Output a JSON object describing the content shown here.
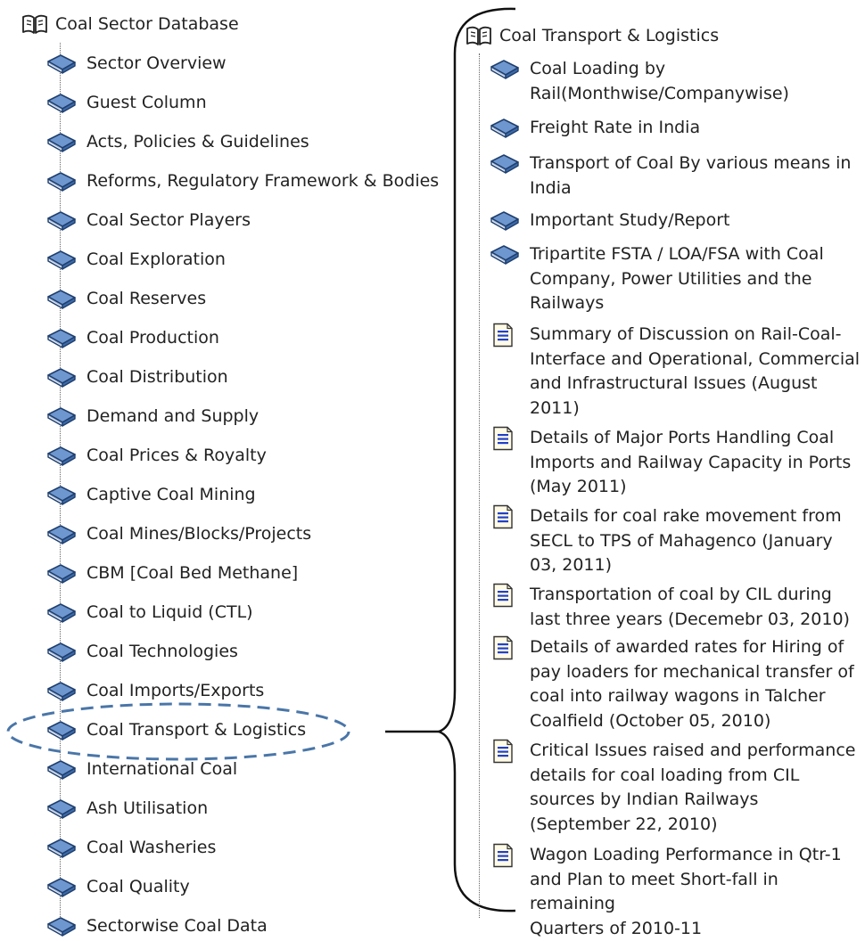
{
  "left_tree": {
    "root_label": "Coal Sector Database",
    "items": [
      {
        "label": "Sector Overview",
        "icon": "book-icon"
      },
      {
        "label": "Guest Column",
        "icon": "book-icon"
      },
      {
        "label": "Acts, Policies & Guidelines",
        "icon": "book-icon"
      },
      {
        "label": "Reforms, Regulatory Framework & Bodies",
        "icon": "book-icon"
      },
      {
        "label": "Coal Sector Players",
        "icon": "book-icon"
      },
      {
        "label": "Coal Exploration",
        "icon": "book-icon"
      },
      {
        "label": "Coal Reserves",
        "icon": "book-icon"
      },
      {
        "label": "Coal Production",
        "icon": "book-icon"
      },
      {
        "label": "Coal Distribution",
        "icon": "book-icon"
      },
      {
        "label": "Demand and Supply",
        "icon": "book-icon"
      },
      {
        "label": "Coal Prices & Royalty",
        "icon": "book-icon"
      },
      {
        "label": "Captive Coal Mining",
        "icon": "book-icon"
      },
      {
        "label": "Coal Mines/Blocks/Projects",
        "icon": "book-icon"
      },
      {
        "label": "CBM [Coal Bed Methane]",
        "icon": "book-icon"
      },
      {
        "label": "Coal to Liquid (CTL)",
        "icon": "book-icon"
      },
      {
        "label": "Coal Technologies",
        "icon": "book-icon"
      },
      {
        "label": "Coal Imports/Exports",
        "icon": "book-icon"
      },
      {
        "label": "Coal Transport & Logistics",
        "icon": "book-icon",
        "highlighted": true
      },
      {
        "label": "International Coal",
        "icon": "book-icon"
      },
      {
        "label": "Ash Utilisation",
        "icon": "book-icon"
      },
      {
        "label": "Coal Washeries",
        "icon": "book-icon"
      },
      {
        "label": "Coal Quality",
        "icon": "book-icon"
      },
      {
        "label": "Sectorwise Coal Data",
        "icon": "book-icon"
      }
    ]
  },
  "right_tree": {
    "root_label": "Coal Transport & Logistics",
    "items": [
      {
        "label": "Coal Loading by\nRail(Monthwise/Companywise)",
        "icon": "book-icon"
      },
      {
        "label": "Freight Rate in India",
        "icon": "book-icon"
      },
      {
        "label": "Transport of Coal By various means in\nIndia",
        "icon": "book-icon"
      },
      {
        "label": "Important Study/Report",
        "icon": "book-icon"
      },
      {
        "label": "Tripartite FSTA / LOA/FSA with Coal\nCompany, Power Utilities and the\nRailways",
        "icon": "book-icon"
      },
      {
        "label": "Summary of Discussion on Rail-Coal-\nInterface and Operational, Commercial\nand Infrastructural Issues (August\n2011)",
        "icon": "document-icon"
      },
      {
        "label": "Details of Major Ports Handling Coal\nImports and Railway Capacity in Ports\n(May 2011)",
        "icon": "document-icon"
      },
      {
        "label": "Details for coal rake movement from\nSECL to TPS of Mahagenco (January\n03, 2011)",
        "icon": "document-icon"
      },
      {
        "label": "Transportation of coal by CIL during\nlast three years (Decemebr 03, 2010)",
        "icon": "document-icon"
      },
      {
        "label": "Details of awarded rates for Hiring of\npay loaders for mechanical transfer of\ncoal into railway wagons in Talcher\nCoalfield (October 05, 2010)",
        "icon": "document-icon"
      },
      {
        "label": "Critical Issues raised and performance\ndetails for coal loading from CIL\nsources by Indian Railways\n(September 22, 2010)",
        "icon": "document-icon"
      },
      {
        "label": "Wagon Loading Performance in Qtr-1\nand Plan to meet Short-fall in remaining\nQuarters of 2010-11",
        "icon": "document-icon"
      }
    ]
  },
  "colors": {
    "book_cover": "#5b86c2",
    "book_edge": "#1f3f6e",
    "highlight_dash": "#4a76a8",
    "bracket": "#111111"
  }
}
